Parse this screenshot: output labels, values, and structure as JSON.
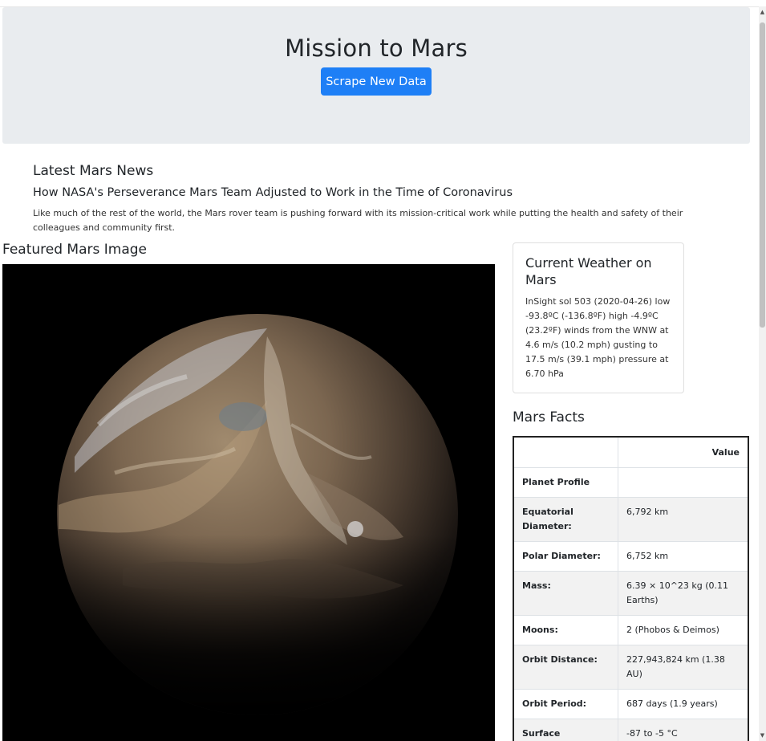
{
  "header": {
    "title": "Mission to Mars",
    "scrape_button": "Scrape New Data"
  },
  "news": {
    "heading": "Latest Mars News",
    "title": "How NASA's Perseverance Mars Team Adjusted to Work in the Time of Coronavirus",
    "paragraph": "Like much of the rest of the world, the Mars rover team is pushing forward with its mission-critical work while putting the health and safety of their colleagues and community first."
  },
  "featured": {
    "heading": "Featured Mars Image"
  },
  "weather": {
    "heading": "Current Weather on Mars",
    "text": "InSight sol 503 (2020-04-26) low -93.8ºC (-136.8ºF) high -4.9ºC (23.2ºF) winds from the WNW at 4.6 m/s (10.2 mph) gusting to 17.5 m/s (39.1 mph) pressure at 6.70 hPa"
  },
  "facts": {
    "heading": "Mars Facts",
    "column_header": "Value",
    "rows": [
      {
        "label": "Planet Profile",
        "value": ""
      },
      {
        "label": "Equatorial Diameter:",
        "value": "6,792 km"
      },
      {
        "label": "Polar Diameter:",
        "value": "6,752 km"
      },
      {
        "label": "Mass:",
        "value": "6.39 × 10^23 kg (0.11 Earths)"
      },
      {
        "label": "Moons:",
        "value": "2 (Phobos & Deimos)"
      },
      {
        "label": "Orbit Distance:",
        "value": "227,943,824 km (1.38 AU)"
      },
      {
        "label": "Orbit Period:",
        "value": "687 days (1.9 years)"
      },
      {
        "label": "Surface Temperature:",
        "value": "-87 to -5 °C"
      }
    ]
  },
  "colors": {
    "accent": "#1e7ff6",
    "jumbotron_bg": "#e9ecef"
  },
  "icons": {
    "scroll_up": "scroll-up-arrow-icon",
    "scroll_down": "scroll-down-arrow-icon"
  }
}
